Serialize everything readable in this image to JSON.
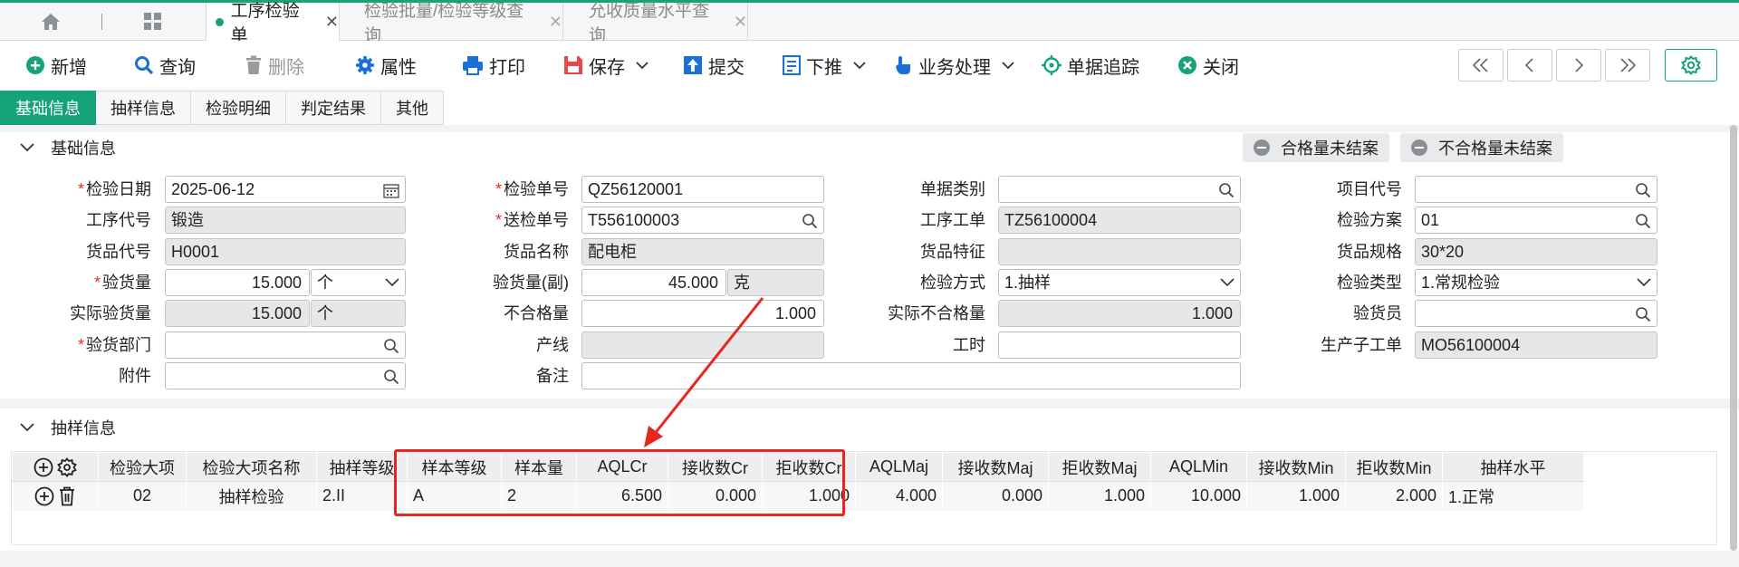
{
  "tabs": {
    "items": [
      {
        "label": "工序检验单",
        "active": true
      },
      {
        "label": "检验批量/检验等级查询",
        "active": false
      },
      {
        "label": "允收质量水平查询",
        "active": false
      }
    ],
    "close": "✕"
  },
  "toolbar": {
    "new": "新增",
    "query": "查询",
    "delete": "删除",
    "properties": "属性",
    "print": "打印",
    "save": "保存",
    "submit": "提交",
    "push_down": "下推",
    "business": "业务处理",
    "trace": "单据追踪",
    "close": "关闭"
  },
  "subtabs": [
    "基础信息",
    "抽样信息",
    "检验明细",
    "判定结果",
    "其他"
  ],
  "basic": {
    "title": "基础信息",
    "pill_qualified": "合格量未结案",
    "pill_unqualified": "不合格量未结案",
    "fields": {
      "inspect_date": {
        "label": "检验日期",
        "value": "2025-06-12"
      },
      "process_code": {
        "label": "工序代号",
        "value": "锻造"
      },
      "goods_code": {
        "label": "货品代号",
        "value": "H0001"
      },
      "inspect_qty": {
        "label": "验货量",
        "value": "15.000",
        "unit": "个"
      },
      "actual_qty": {
        "label": "实际验货量",
        "value": "15.000",
        "unit": "个"
      },
      "dept": {
        "label": "验货部门",
        "value": ""
      },
      "attachment": {
        "label": "附件",
        "value": ""
      },
      "inspect_no": {
        "label": "检验单号",
        "value": "QZ56120001"
      },
      "submit_no": {
        "label": "送检单号",
        "value": "T556100003"
      },
      "goods_name": {
        "label": "货品名称",
        "value": "配电柜"
      },
      "inspect_qty_sub": {
        "label": "验货量(副)",
        "value": "45.000",
        "unit": "克"
      },
      "unqualified_qty": {
        "label": "不合格量",
        "value": "1.000"
      },
      "line": {
        "label": "产线",
        "value": ""
      },
      "remark": {
        "label": "备注",
        "value": ""
      },
      "doc_type": {
        "label": "单据类别",
        "value": ""
      },
      "process_order": {
        "label": "工序工单",
        "value": "TZ56100004"
      },
      "goods_feature": {
        "label": "货品特征",
        "value": ""
      },
      "inspect_method": {
        "label": "检验方式",
        "value": "1.抽样"
      },
      "actual_unqualified": {
        "label": "实际不合格量",
        "value": "1.000"
      },
      "work_hours": {
        "label": "工时",
        "value": ""
      },
      "project_code": {
        "label": "项目代号",
        "value": ""
      },
      "inspect_plan": {
        "label": "检验方案",
        "value": "01"
      },
      "goods_spec": {
        "label": "货品规格",
        "value": "30*20"
      },
      "inspect_type": {
        "label": "检验类型",
        "value": "1.常规检验"
      },
      "inspector": {
        "label": "验货员",
        "value": ""
      },
      "sub_order": {
        "label": "生产子工单",
        "value": "MO56100004"
      }
    }
  },
  "sampling": {
    "title": "抽样信息",
    "columns": [
      "检验大项",
      "检验大项名称",
      "抽样等级",
      "样本等级",
      "样本量",
      "AQLCr",
      "接收数Cr",
      "拒收数Cr",
      "AQLMaj",
      "接收数Maj",
      "拒收数Maj",
      "AQLMin",
      "接收数Min",
      "拒收数Min",
      "抽样水平"
    ],
    "rows": [
      [
        "02",
        "抽样检验",
        "2.II",
        "A",
        "2",
        "6.500",
        "0.000",
        "1.000",
        "4.000",
        "0.000",
        "1.000",
        "10.000",
        "1.000",
        "2.000",
        "1.正常"
      ]
    ]
  },
  "colors": {
    "accent": "#16a37a",
    "highlight": "#e8261e"
  }
}
